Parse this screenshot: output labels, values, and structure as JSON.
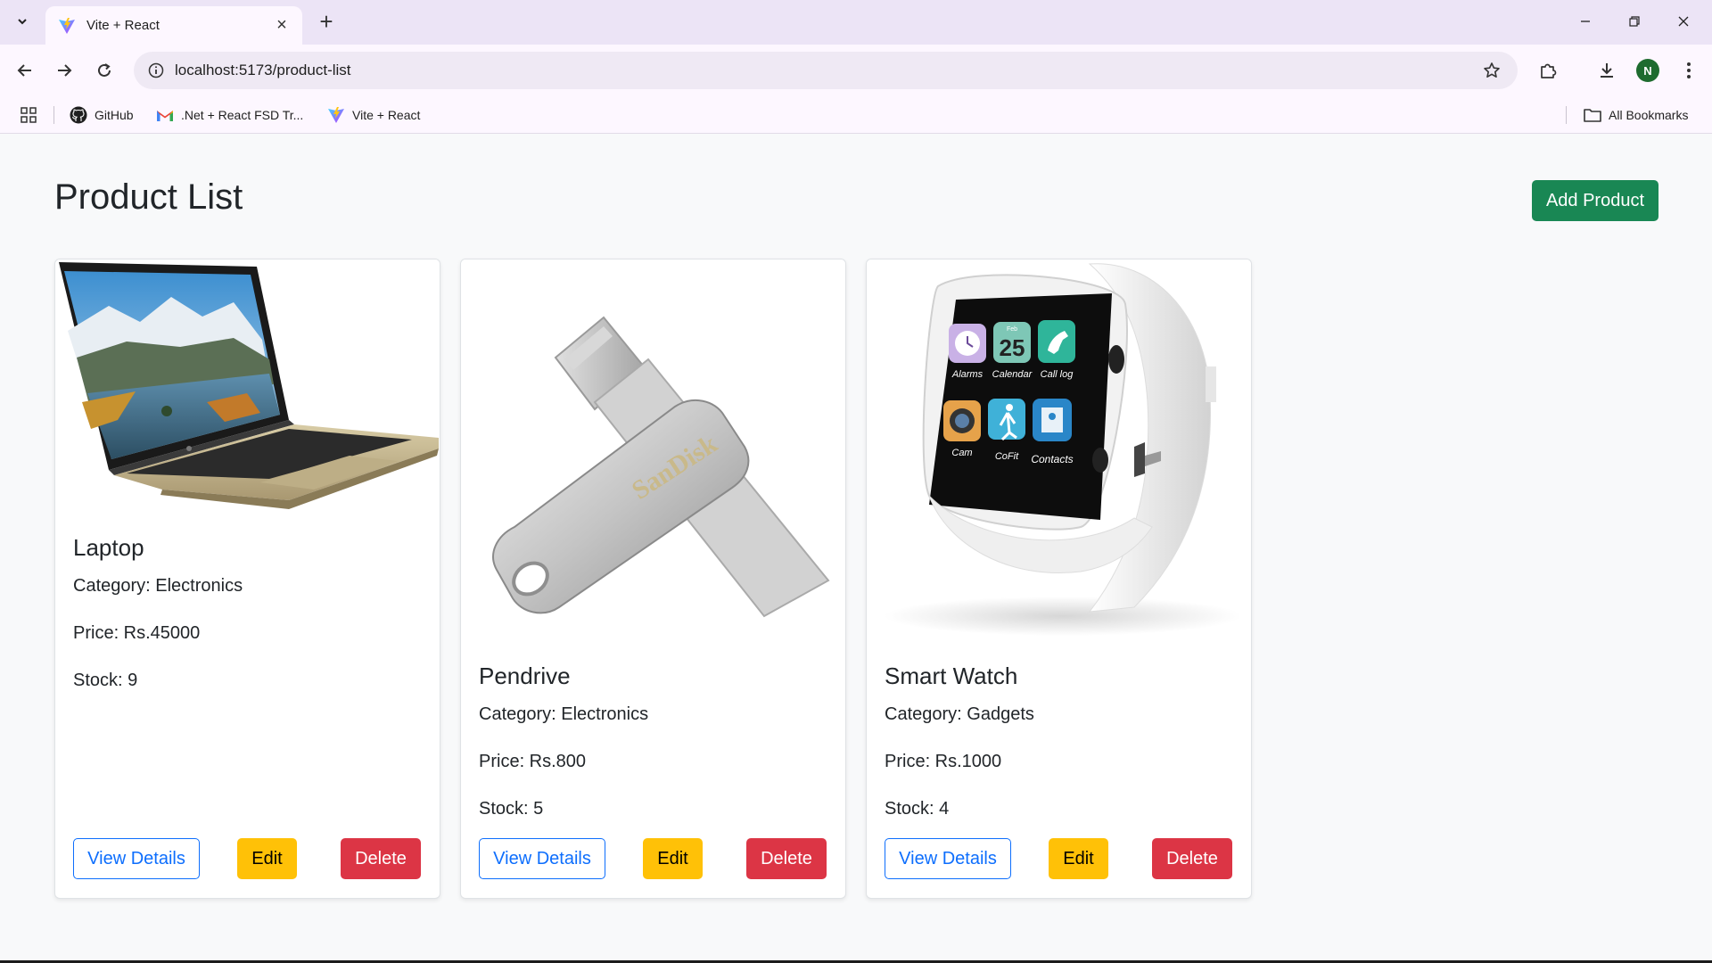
{
  "browser": {
    "tab_title": "Vite + React",
    "url": "localhost:5173/product-list",
    "avatar_letter": "N",
    "bookmarks": [
      {
        "label": "GitHub",
        "icon": "github-icon"
      },
      {
        "label": ".Net + React FSD Tr...",
        "icon": "gmail-icon"
      },
      {
        "label": "Vite + React",
        "icon": "vite-icon"
      }
    ],
    "all_bookmarks_label": "All Bookmarks"
  },
  "page": {
    "title": "Product List",
    "add_button_label": "Add Product"
  },
  "products": [
    {
      "name": "Laptop",
      "category": "Category: Electronics",
      "price": "Price: Rs.45000",
      "stock": "Stock: 9",
      "image": "laptop-image"
    },
    {
      "name": "Pendrive",
      "category": "Category: Electronics",
      "price": "Price: Rs.800",
      "stock": "Stock: 5",
      "image": "pendrive-image",
      "image_text": "SanDisk"
    },
    {
      "name": "Smart Watch",
      "category": "Category: Gadgets",
      "price": "Price: Rs.1000",
      "stock": "Stock: 4",
      "image": "smartwatch-image",
      "image_text": {
        "date_header": "Feb",
        "date": "25",
        "apps": [
          "Alarms",
          "Calendar",
          "Call log",
          "Cam",
          "CoFit",
          "Contacts"
        ]
      }
    }
  ],
  "actions": {
    "view": "View Details",
    "edit": "Edit",
    "delete": "Delete"
  },
  "colors": {
    "success": "#198754",
    "primary": "#0d6efd",
    "warning": "#ffc107",
    "danger": "#dc3545"
  }
}
